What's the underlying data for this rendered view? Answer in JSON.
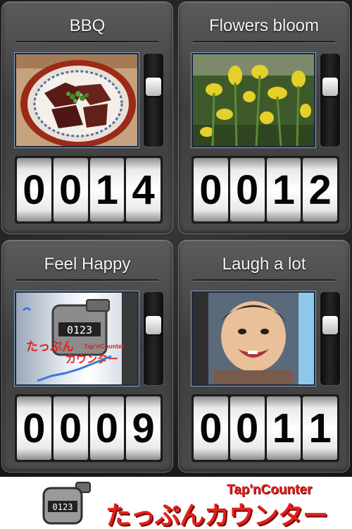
{
  "counters": [
    {
      "title": "BBQ",
      "digits": [
        "0",
        "0",
        "1",
        "4"
      ],
      "photo": "grilled-meat-photo"
    },
    {
      "title": "Flowers bloom",
      "digits": [
        "0",
        "0",
        "1",
        "2"
      ],
      "photo": "yellow-flowers-photo"
    },
    {
      "title": "Feel Happy",
      "digits": [
        "0",
        "0",
        "0",
        "9"
      ],
      "photo": "app-icon-photo"
    },
    {
      "title": "Laugh a lot",
      "digits": [
        "0",
        "0",
        "1",
        "1"
      ],
      "photo": "smiling-baby-photo"
    }
  ],
  "app_icon": {
    "digits": "0123",
    "jp_name": "たっぷん",
    "jp_name2": "カウンター",
    "en_name": "Tap'nCounter"
  },
  "footer": {
    "jp_brand": "たっぷんカウンター",
    "en_brand": "Tap'nCounter",
    "counter_digits": "0123"
  },
  "colors": {
    "brand_red": "#e2201c",
    "panel_gray": "#4a4a4a"
  }
}
